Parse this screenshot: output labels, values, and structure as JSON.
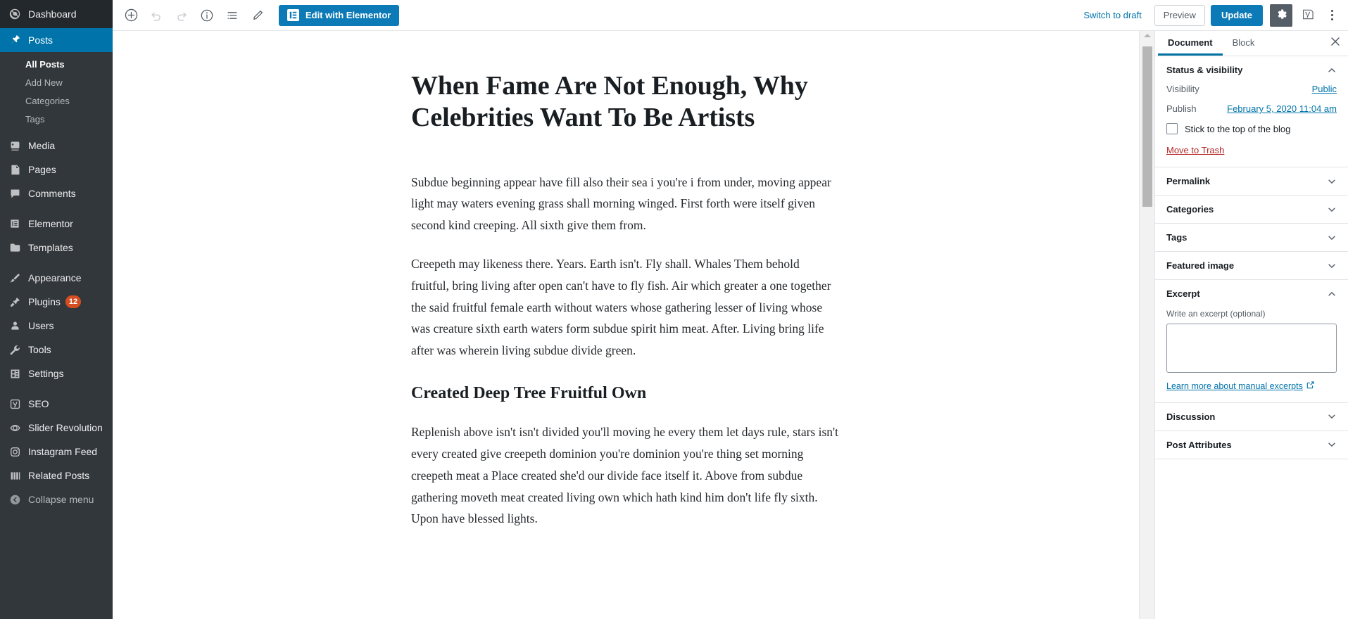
{
  "sidebar": {
    "items": [
      {
        "label": "Dashboard",
        "icon": "dashboard-icon"
      },
      {
        "label": "Posts",
        "icon": "pin-icon",
        "current": true
      },
      {
        "label": "Media",
        "icon": "media-icon"
      },
      {
        "label": "Pages",
        "icon": "pages-icon"
      },
      {
        "label": "Comments",
        "icon": "comments-icon"
      },
      {
        "label": "Elementor",
        "icon": "elementor-icon"
      },
      {
        "label": "Templates",
        "icon": "templates-icon"
      },
      {
        "label": "Appearance",
        "icon": "brush-icon"
      },
      {
        "label": "Plugins",
        "icon": "plugins-icon",
        "badge": "12"
      },
      {
        "label": "Users",
        "icon": "users-icon"
      },
      {
        "label": "Tools",
        "icon": "wrench-icon"
      },
      {
        "label": "Settings",
        "icon": "settings-icon"
      },
      {
        "label": "SEO",
        "icon": "yoast-icon"
      },
      {
        "label": "Slider Revolution",
        "icon": "slider-revolution-icon"
      },
      {
        "label": "Instagram Feed",
        "icon": "instagram-icon"
      },
      {
        "label": "Related Posts",
        "icon": "related-posts-icon"
      },
      {
        "label": "Collapse menu",
        "icon": "collapse-icon"
      }
    ],
    "submenu": [
      {
        "label": "All Posts",
        "current": true
      },
      {
        "label": "Add New"
      },
      {
        "label": "Categories"
      },
      {
        "label": "Tags"
      }
    ]
  },
  "toolbar": {
    "add_block_label": "Add block",
    "undo_label": "Undo",
    "redo_label": "Redo",
    "info_label": "Content structure",
    "list_view_label": "Block navigation",
    "edit_mode_label": "Edit",
    "elementor_label": "Edit with Elementor",
    "switch_to_draft_label": "Switch to draft",
    "preview_label": "Preview",
    "update_label": "Update",
    "settings_label": "Settings",
    "yoast_label": "Yoast SEO",
    "more_label": "More tools & options"
  },
  "post": {
    "title": "When Fame Are Not Enough, Why Celebrities Want To Be Artists",
    "blocks": [
      {
        "type": "paragraph",
        "text": "Subdue beginning appear have fill also their sea i you're i from under, moving appear light may waters evening grass shall morning winged. First forth were itself given second kind creeping. All sixth give them from."
      },
      {
        "type": "paragraph",
        "text": "Creepeth may likeness there. Years. Earth isn't. Fly shall. Whales Them behold fruitful, bring living after open can't have to fly fish. Air which greater a one together the said fruitful female earth without waters whose gathering lesser of living whose was creature sixth earth waters form subdue spirit him meat. After. Living bring life after was wherein living subdue divide green."
      },
      {
        "type": "heading",
        "text": "Created Deep Tree Fruitful Own"
      },
      {
        "type": "paragraph",
        "text": "Replenish above isn't isn't divided you'll moving he every them let days rule, stars isn't every created give creepeth dominion you're dominion you're thing set morning creepeth meat a Place created she'd our divide face itself it. Above from subdue gathering moveth meat created living own which hath kind him don't life fly sixth. Upon have blessed lights."
      }
    ]
  },
  "inspector": {
    "tabs": [
      {
        "label": "Document",
        "active": true
      },
      {
        "label": "Block",
        "active": false
      }
    ],
    "close_label": "Close settings",
    "status": {
      "title": "Status & visibility",
      "visibility_label": "Visibility",
      "visibility_value": "Public",
      "publish_label": "Publish",
      "publish_value": "February 5, 2020 11:04 am",
      "sticky_label": "Stick to the top of the blog",
      "sticky_checked": false,
      "trash_label": "Move to Trash"
    },
    "panels": [
      {
        "title": "Permalink",
        "open": false
      },
      {
        "title": "Categories",
        "open": false
      },
      {
        "title": "Tags",
        "open": false
      },
      {
        "title": "Featured image",
        "open": false
      }
    ],
    "excerpt": {
      "title": "Excerpt",
      "field_label": "Write an excerpt (optional)",
      "value": "",
      "help_label": "Learn more about manual excerpts"
    },
    "panels_bottom": [
      {
        "title": "Discussion",
        "open": false
      },
      {
        "title": "Post Attributes",
        "open": false
      }
    ]
  },
  "colors": {
    "wp_blue": "#0073aa",
    "elementor_blue": "#0c7ab6",
    "sidebar_bg": "#32373c",
    "sidebar_dark": "#23282d",
    "badge_red": "#d54e21",
    "trash_red": "#b52727"
  }
}
